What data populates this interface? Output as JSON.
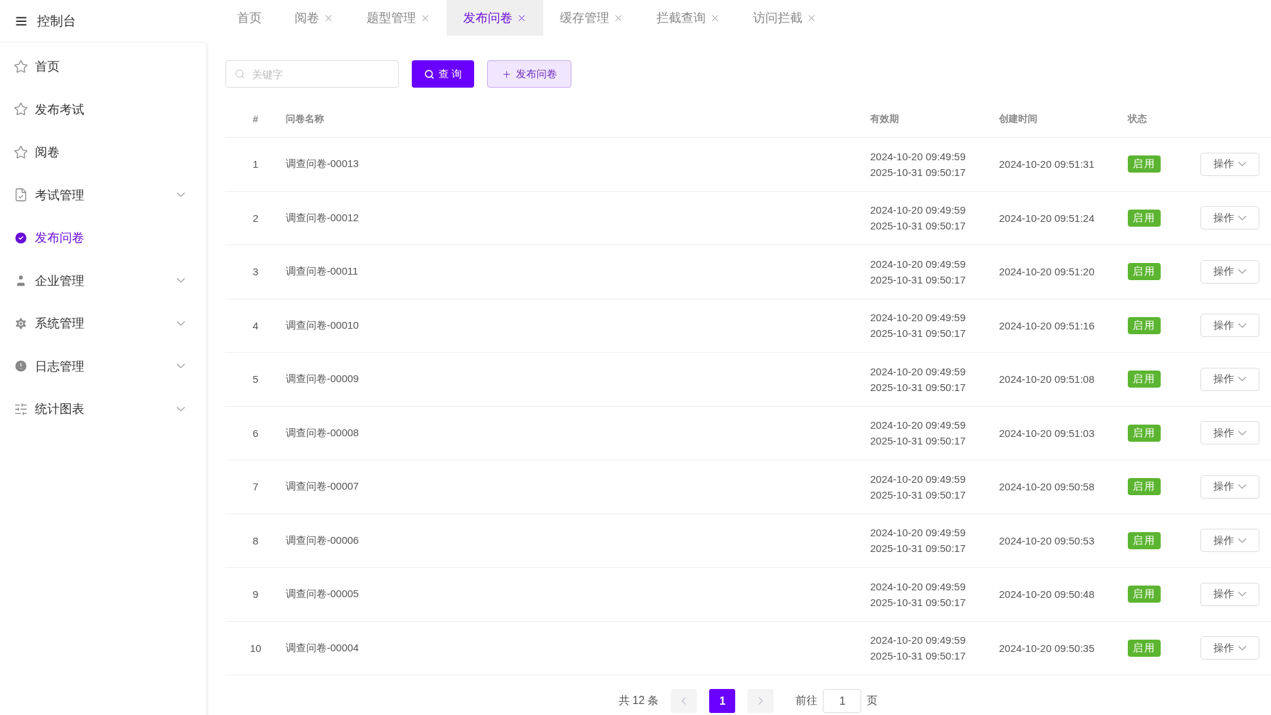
{
  "brand": {
    "title": "控制台"
  },
  "sidebar": {
    "items": [
      {
        "label": "首页",
        "kind": "star",
        "selected": false,
        "expandable": false
      },
      {
        "label": "发布考试",
        "kind": "star",
        "selected": false,
        "expandable": false
      },
      {
        "label": "阅卷",
        "kind": "star",
        "selected": false,
        "expandable": false
      },
      {
        "label": "考试管理",
        "kind": "doc",
        "selected": false,
        "expandable": true
      },
      {
        "label": "发布问卷",
        "kind": "check",
        "selected": true,
        "expandable": false
      },
      {
        "label": "企业管理",
        "kind": "user",
        "selected": false,
        "expandable": true
      },
      {
        "label": "系统管理",
        "kind": "gear",
        "selected": false,
        "expandable": true
      },
      {
        "label": "日志管理",
        "kind": "alert",
        "selected": false,
        "expandable": true
      },
      {
        "label": "统计图表",
        "kind": "sliders",
        "selected": false,
        "expandable": true
      }
    ]
  },
  "tabs": [
    {
      "label": "首页",
      "selected": false,
      "closable": false
    },
    {
      "label": "阅卷",
      "selected": false,
      "closable": true
    },
    {
      "label": "题型管理",
      "selected": false,
      "closable": true
    },
    {
      "label": "发布问卷",
      "selected": true,
      "closable": true
    },
    {
      "label": "缓存管理",
      "selected": false,
      "closable": true
    },
    {
      "label": "拦截查询",
      "selected": false,
      "closable": true
    },
    {
      "label": "访问拦截",
      "selected": false,
      "closable": true
    }
  ],
  "toolbar": {
    "search_placeholder": "关键字",
    "query_button": "查 询",
    "publish_button": "发布问卷"
  },
  "table": {
    "columns": [
      "#",
      "问卷名称",
      "有效期",
      "创建时间",
      "状态"
    ],
    "rows": [
      {
        "index": "1",
        "name": "调查问卷-00013",
        "valid_from": "2024-10-20 09:49:59",
        "valid_to": "2025-10-31 09:50:17",
        "created": "2024-10-20 09:51:31",
        "status": "启用",
        "action": "操作"
      },
      {
        "index": "2",
        "name": "调查问卷-00012",
        "valid_from": "2024-10-20 09:49:59",
        "valid_to": "2025-10-31 09:50:17",
        "created": "2024-10-20 09:51:24",
        "status": "启用",
        "action": "操作"
      },
      {
        "index": "3",
        "name": "调查问卷-00011",
        "valid_from": "2024-10-20 09:49:59",
        "valid_to": "2025-10-31 09:50:17",
        "created": "2024-10-20 09:51:20",
        "status": "启用",
        "action": "操作"
      },
      {
        "index": "4",
        "name": "调查问卷-00010",
        "valid_from": "2024-10-20 09:49:59",
        "valid_to": "2025-10-31 09:50:17",
        "created": "2024-10-20 09:51:16",
        "status": "启用",
        "action": "操作"
      },
      {
        "index": "5",
        "name": "调查问卷-00009",
        "valid_from": "2024-10-20 09:49:59",
        "valid_to": "2025-10-31 09:50:17",
        "created": "2024-10-20 09:51:08",
        "status": "启用",
        "action": "操作"
      },
      {
        "index": "6",
        "name": "调查问卷-00008",
        "valid_from": "2024-10-20 09:49:59",
        "valid_to": "2025-10-31 09:50:17",
        "created": "2024-10-20 09:51:03",
        "status": "启用",
        "action": "操作"
      },
      {
        "index": "7",
        "name": "调查问卷-00007",
        "valid_from": "2024-10-20 09:49:59",
        "valid_to": "2025-10-31 09:50:17",
        "created": "2024-10-20 09:50:58",
        "status": "启用",
        "action": "操作"
      },
      {
        "index": "8",
        "name": "调查问卷-00006",
        "valid_from": "2024-10-20 09:49:59",
        "valid_to": "2025-10-31 09:50:17",
        "created": "2024-10-20 09:50:53",
        "status": "启用",
        "action": "操作"
      },
      {
        "index": "9",
        "name": "调查问卷-00005",
        "valid_from": "2024-10-20 09:49:59",
        "valid_to": "2025-10-31 09:50:17",
        "created": "2024-10-20 09:50:48",
        "status": "启用",
        "action": "操作"
      },
      {
        "index": "10",
        "name": "调查问卷-00004",
        "valid_from": "2024-10-20 09:49:59",
        "valid_to": "2025-10-31 09:50:17",
        "created": "2024-10-20 09:50:35",
        "status": "启用",
        "action": "操作"
      }
    ]
  },
  "pagination": {
    "total": "共 12 条",
    "pages": [
      {
        "label": "1",
        "selected": true
      }
    ],
    "goto_label": "前往",
    "goto_value": "1",
    "page_suffix": "页"
  }
}
